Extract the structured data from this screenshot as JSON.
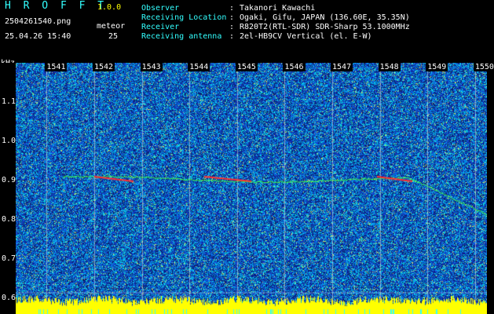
{
  "app": {
    "brand": "H R O F F T",
    "version": "1.0.0"
  },
  "capture": {
    "filename": "2504261540.png",
    "datetime": "25.04.26 15:40",
    "meteor_label": "meteor",
    "meteor_count": "25"
  },
  "info": [
    {
      "label": "Observer",
      "value": "Takanori Kawachi"
    },
    {
      "label": "Receiving Location",
      "value": "Ogaki, Gifu, JAPAN (136.60E, 35.35N)"
    },
    {
      "label": "Receiver",
      "value": "R820T2(RTL-SDR) SDR-Sharp 53.1000MHz"
    },
    {
      "label": "Receiving antenna",
      "value": "2el-HB9CV Vertical (el. E-W)"
    }
  ],
  "info_separator": ":",
  "axis": {
    "y_unit": "kHz",
    "y_ticks": [
      "1.1",
      "1.0",
      "0.9",
      "0.8",
      "0.7",
      "0.6"
    ],
    "y_values": [
      1.1,
      1.0,
      0.9,
      0.8,
      0.7,
      0.6
    ],
    "y_range": [
      0.56,
      1.2
    ],
    "x_ticks": [
      "1541",
      "1542",
      "1543",
      "1544",
      "1545",
      "1546",
      "1547",
      "1548",
      "1549",
      "1550"
    ],
    "x_range": [
      1540.35,
      1550.25
    ]
  },
  "colors": {
    "background": "#000000",
    "noise_base": "#1a3cb4",
    "noise_hot": "#00c8c8",
    "echo": "#ff3030",
    "signal_trace": "#40ff40",
    "baseline": "#ffff00",
    "header_label": "#33ffff"
  }
}
